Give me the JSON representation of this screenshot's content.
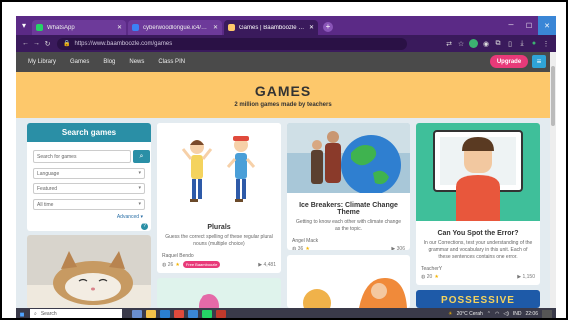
{
  "browser": {
    "tabs": [
      {
        "label": "WhatsApp",
        "color": "#25d366",
        "active": false
      },
      {
        "label": "cyberwoodlongue.ic4/d9epil",
        "color": "#3b82f6",
        "active": false
      },
      {
        "label": "Games | Baamboozle - Baamboo",
        "color": "#fdc86b",
        "active": true
      }
    ],
    "url": "https://www.baamboozle.com/games"
  },
  "site": {
    "nav": [
      "My Library",
      "Games",
      "Blog",
      "News",
      "Class PIN"
    ],
    "upgrade_label": "Upgrade"
  },
  "banner": {
    "title": "GAMES",
    "subtitle": "2 million games made by teachers"
  },
  "search": {
    "title": "Search games",
    "placeholder": "Search for games",
    "language": "Language",
    "sort": "Featured",
    "time": "All time",
    "advanced": "Advanced"
  },
  "cards": [
    {
      "title": "Plurals",
      "desc": "Guess the correct spelling of these regular plural nouns (multiple choice)",
      "author": "Raquel Bendo",
      "rating": "26",
      "badge": "Free Baamboozle",
      "plays": "4,481"
    },
    {
      "title": "Ice Breakers: Climate Change Theme",
      "desc": "Getting to know each other with climate change as the topic.",
      "author": "Angel Mack",
      "rating": "36",
      "plays": "306"
    },
    {
      "title": "Can You Spot the Error?",
      "desc": "In our Corrections, test your understanding of the grammar and vocabulary in this unit. Each of these sentences contains one error.",
      "author": "TeacherY",
      "rating": "20",
      "plays": "1,150"
    }
  ],
  "bottom_card_text": "POSSESSIVE",
  "taskbar": {
    "search": "Search",
    "weather": "20°C Cerah",
    "lang": "IND",
    "time": "22:06"
  }
}
